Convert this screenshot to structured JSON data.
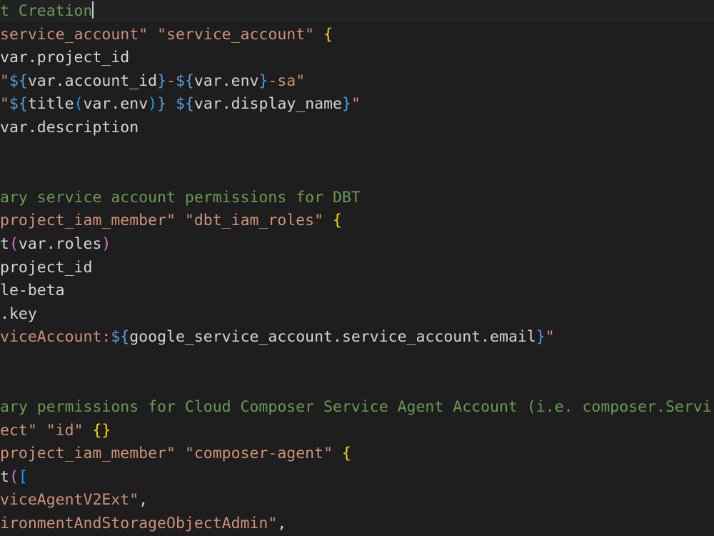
{
  "colors": {
    "background": "#1e1e1e",
    "default": "#d4d4d4",
    "string": "#ce9178",
    "comment": "#6a9955",
    "variable": "#9cdcfe",
    "interp": "#569cd6",
    "bracket_gold": "#ffd700",
    "bracket_pink": "#da70d6",
    "bracket_blue": "#179fff"
  },
  "lines": [
    [
      {
        "t": "t Creation",
        "c": "#6a9955"
      }
    ],
    [
      {
        "t": "service_account\"",
        "c": "#ce9178"
      },
      {
        "t": " ",
        "c": "#d4d4d4"
      },
      {
        "t": "\"service_account\"",
        "c": "#ce9178"
      },
      {
        "t": " ",
        "c": "#d4d4d4"
      },
      {
        "t": "{",
        "c": "#ffd700"
      }
    ],
    [
      {
        "t": "var.project_id",
        "c": "#d4d4d4"
      }
    ],
    [
      {
        "t": "\"",
        "c": "#ce9178"
      },
      {
        "t": "${",
        "c": "#569cd6"
      },
      {
        "t": "var.account_id",
        "c": "#d4d4d4"
      },
      {
        "t": "}",
        "c": "#569cd6"
      },
      {
        "t": "-",
        "c": "#ce9178"
      },
      {
        "t": "${",
        "c": "#569cd6"
      },
      {
        "t": "var.env",
        "c": "#d4d4d4"
      },
      {
        "t": "}",
        "c": "#569cd6"
      },
      {
        "t": "-sa\"",
        "c": "#ce9178"
      }
    ],
    [
      {
        "t": "\"",
        "c": "#ce9178"
      },
      {
        "t": "${",
        "c": "#569cd6"
      },
      {
        "t": "title",
        "c": "#d4d4d4"
      },
      {
        "t": "(",
        "c": "#179fff"
      },
      {
        "t": "var.env",
        "c": "#d4d4d4"
      },
      {
        "t": ")",
        "c": "#179fff"
      },
      {
        "t": "}",
        "c": "#569cd6"
      },
      {
        "t": " ",
        "c": "#ce9178"
      },
      {
        "t": "${",
        "c": "#569cd6"
      },
      {
        "t": "var.display_name",
        "c": "#d4d4d4"
      },
      {
        "t": "}",
        "c": "#569cd6"
      },
      {
        "t": "\"",
        "c": "#ce9178"
      }
    ],
    [
      {
        "t": "var.description",
        "c": "#d4d4d4"
      }
    ],
    [],
    [],
    [
      {
        "t": "ary service account permissions for DBT",
        "c": "#6a9955"
      }
    ],
    [
      {
        "t": "project_iam_member\"",
        "c": "#ce9178"
      },
      {
        "t": " ",
        "c": "#d4d4d4"
      },
      {
        "t": "\"dbt_iam_roles\"",
        "c": "#ce9178"
      },
      {
        "t": " ",
        "c": "#d4d4d4"
      },
      {
        "t": "{",
        "c": "#ffd700"
      }
    ],
    [
      {
        "t": "t",
        "c": "#d4d4d4"
      },
      {
        "t": "(",
        "c": "#da70d6"
      },
      {
        "t": "var.roles",
        "c": "#d4d4d4"
      },
      {
        "t": ")",
        "c": "#da70d6"
      }
    ],
    [
      {
        "t": "project_id",
        "c": "#d4d4d4"
      }
    ],
    [
      {
        "t": "le-beta",
        "c": "#d4d4d4"
      }
    ],
    [
      {
        "t": ".key",
        "c": "#d4d4d4"
      }
    ],
    [
      {
        "t": "viceAccount:",
        "c": "#ce9178"
      },
      {
        "t": "${",
        "c": "#569cd6"
      },
      {
        "t": "google_service_account.service_account.email",
        "c": "#d4d4d4"
      },
      {
        "t": "}",
        "c": "#569cd6"
      },
      {
        "t": "\"",
        "c": "#ce9178"
      }
    ],
    [],
    [],
    [
      {
        "t": "ary permissions for Cloud Composer Service Agent Account (i.e. composer.Servi",
        "c": "#6a9955"
      }
    ],
    [
      {
        "t": "ect\"",
        "c": "#ce9178"
      },
      {
        "t": " ",
        "c": "#d4d4d4"
      },
      {
        "t": "\"id\"",
        "c": "#ce9178"
      },
      {
        "t": " ",
        "c": "#d4d4d4"
      },
      {
        "t": "{}",
        "c": "#ffd700"
      }
    ],
    [
      {
        "t": "project_iam_member\"",
        "c": "#ce9178"
      },
      {
        "t": " ",
        "c": "#d4d4d4"
      },
      {
        "t": "\"composer-agent\"",
        "c": "#ce9178"
      },
      {
        "t": " ",
        "c": "#d4d4d4"
      },
      {
        "t": "{",
        "c": "#ffd700"
      }
    ],
    [
      {
        "t": "t",
        "c": "#d4d4d4"
      },
      {
        "t": "(",
        "c": "#da70d6"
      },
      {
        "t": "[",
        "c": "#179fff"
      }
    ],
    [
      {
        "t": "viceAgentV2Ext\"",
        "c": "#ce9178"
      },
      {
        "t": ",",
        "c": "#d4d4d4"
      }
    ],
    [
      {
        "t": "ironmentAndStorageObjectAdmin\"",
        "c": "#ce9178"
      },
      {
        "t": ",",
        "c": "#d4d4d4"
      }
    ]
  ]
}
